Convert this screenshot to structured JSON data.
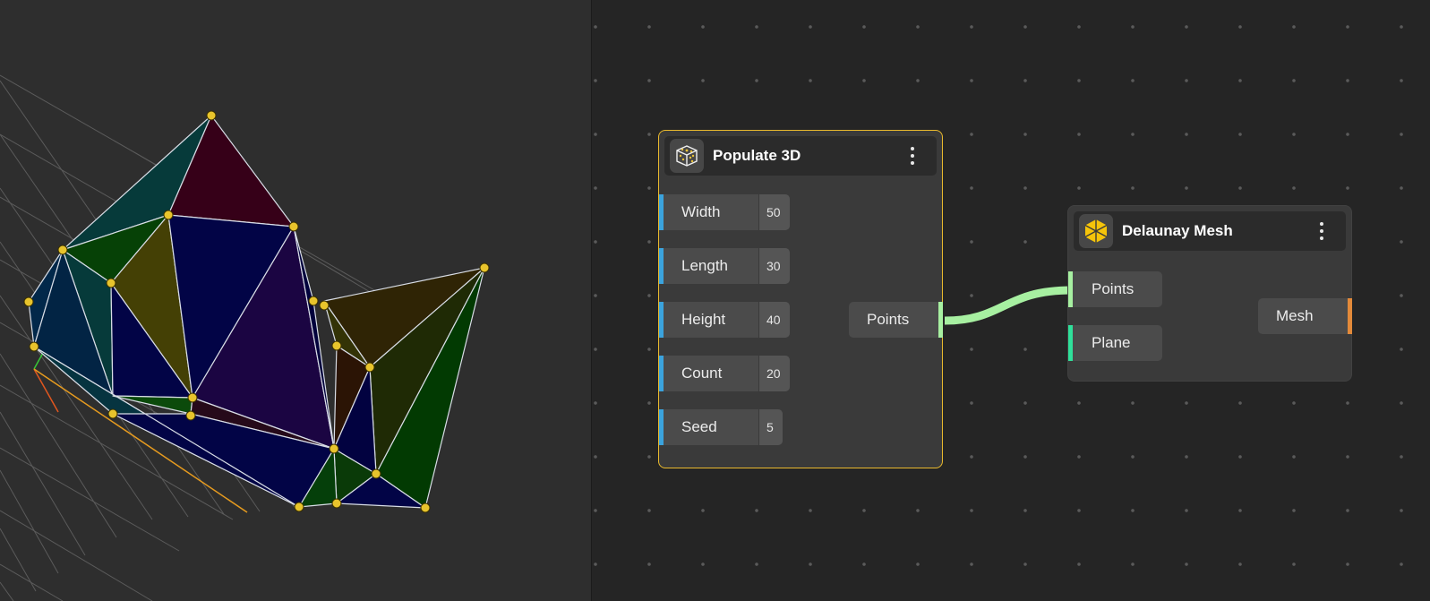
{
  "viewport": {
    "colors": {
      "background": "#2e2e2e",
      "grid": "#6a6a6a",
      "vertex": "#e8c42c",
      "edge": "#d8dde6",
      "axis_x": "#e0561f",
      "axis_y": "#37c837",
      "axis_z": "#e69b1f"
    }
  },
  "populate_node": {
    "title": "Populate 3D",
    "icon": "dice-icon",
    "params": [
      {
        "label": "Width",
        "value": "50"
      },
      {
        "label": "Length",
        "value": "30"
      },
      {
        "label": "Height",
        "value": "40"
      },
      {
        "label": "Count",
        "value": "20"
      },
      {
        "label": "Seed",
        "value": "5"
      }
    ],
    "output": {
      "label": "Points",
      "color": "#a7f0a1"
    },
    "accent": "#e9b92d"
  },
  "delaunay_node": {
    "title": "Delaunay Mesh",
    "icon": "delaunay-icon",
    "inputs": [
      {
        "label": "Points",
        "color": "#a7f0a1"
      },
      {
        "label": "Plane",
        "color": "#2fe09a"
      }
    ],
    "output": {
      "label": "Mesh",
      "color": "#e38a3a"
    }
  },
  "param_port_color": "#3ba3dd",
  "wire_color": "#a7f0a1"
}
